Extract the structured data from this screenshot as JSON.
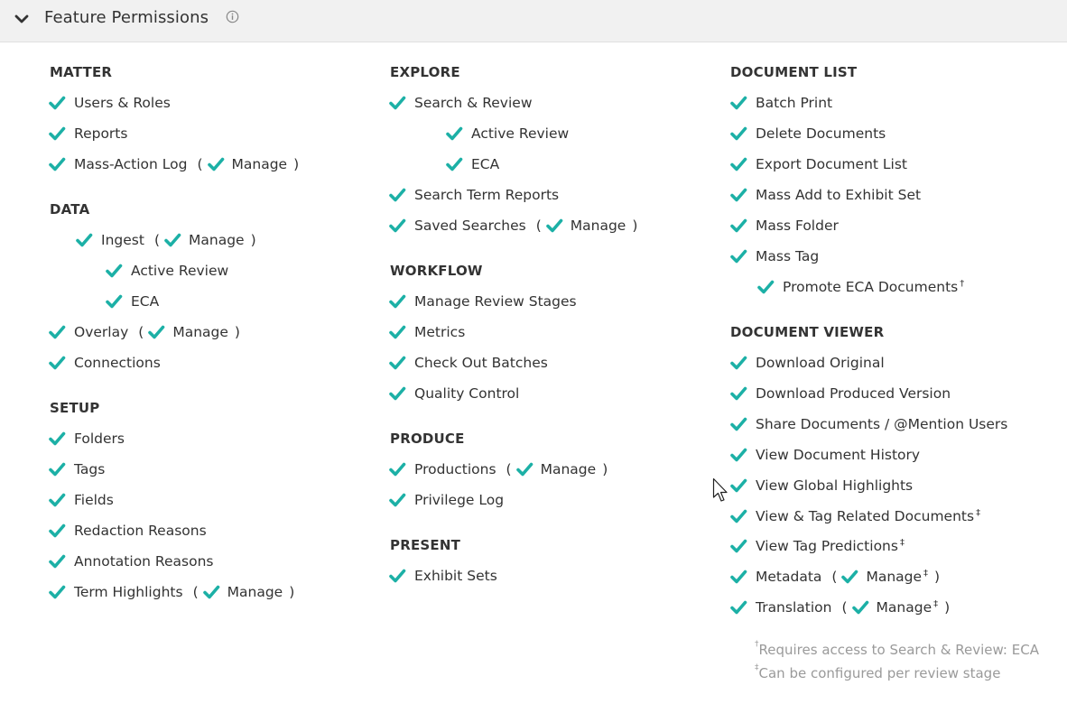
{
  "header": {
    "title": "Feature Permissions",
    "expand_icon": "chevron-down-icon",
    "info_icon": "info-circle-icon"
  },
  "colors": {
    "check": "#1cb0a6",
    "header_bg": "#f1f1f1",
    "footnote": "#9a9a9a"
  },
  "columns": [
    {
      "sections": [
        {
          "title": "MATTER",
          "items": [
            {
              "label": "Users & Roles"
            },
            {
              "label": "Reports"
            },
            {
              "label": "Mass-Action Log",
              "manage": "Manage"
            }
          ]
        },
        {
          "title": "DATA",
          "items": [
            {
              "label": "Ingest",
              "manage": "Manage"
            },
            {
              "label": "Active Review"
            },
            {
              "label": "ECA"
            },
            {
              "label": "Overlay",
              "manage": "Manage"
            },
            {
              "label": "Connections"
            }
          ]
        },
        {
          "title": "SETUP",
          "items": [
            {
              "label": "Folders"
            },
            {
              "label": "Tags"
            },
            {
              "label": "Fields"
            },
            {
              "label": "Redaction Reasons"
            },
            {
              "label": "Annotation Reasons"
            },
            {
              "label": "Term Highlights",
              "manage": "Manage"
            }
          ]
        }
      ]
    },
    {
      "sections": [
        {
          "title": "EXPLORE",
          "items": [
            {
              "label": "Search & Review"
            },
            {
              "label": "Active Review"
            },
            {
              "label": "ECA"
            },
            {
              "label": "Search Term Reports"
            },
            {
              "label": "Saved Searches",
              "manage": "Manage"
            }
          ]
        },
        {
          "title": "WORKFLOW",
          "items": [
            {
              "label": "Manage Review Stages"
            },
            {
              "label": "Metrics"
            },
            {
              "label": "Check Out Batches"
            },
            {
              "label": "Quality Control"
            }
          ]
        },
        {
          "title": "PRODUCE",
          "items": [
            {
              "label": "Productions",
              "manage": "Manage"
            },
            {
              "label": "Privilege Log"
            }
          ]
        },
        {
          "title": "PRESENT",
          "items": [
            {
              "label": "Exhibit Sets"
            }
          ]
        }
      ]
    },
    {
      "sections": [
        {
          "title": "DOCUMENT LIST",
          "items": [
            {
              "label": "Batch Print"
            },
            {
              "label": "Delete Documents"
            },
            {
              "label": "Export Document List"
            },
            {
              "label": "Mass Add to Exhibit Set"
            },
            {
              "label": "Mass Folder"
            },
            {
              "label": "Mass Tag"
            },
            {
              "label": "Promote ECA Documents",
              "sup": "†"
            }
          ]
        },
        {
          "title": "DOCUMENT VIEWER",
          "items": [
            {
              "label": "Download Original"
            },
            {
              "label": "Download Produced Version"
            },
            {
              "label": "Share Documents / @Mention Users"
            },
            {
              "label": "View Document History"
            },
            {
              "label": "View Global Highlights"
            },
            {
              "label": "View & Tag Related Documents",
              "sup": "‡"
            },
            {
              "label": "View Tag Predictions",
              "sup": "‡"
            },
            {
              "label": "Metadata",
              "manage": "Manage",
              "manage_sup": "‡"
            },
            {
              "label": "Translation",
              "manage": "Manage",
              "manage_sup": "‡"
            }
          ]
        }
      ]
    }
  ],
  "footnotes": {
    "dagger_mark": "†",
    "dagger_text": "Requires access to Search & Review: ECA",
    "ddagger_mark": "‡",
    "ddagger_text": "Can be configured per review stage"
  }
}
